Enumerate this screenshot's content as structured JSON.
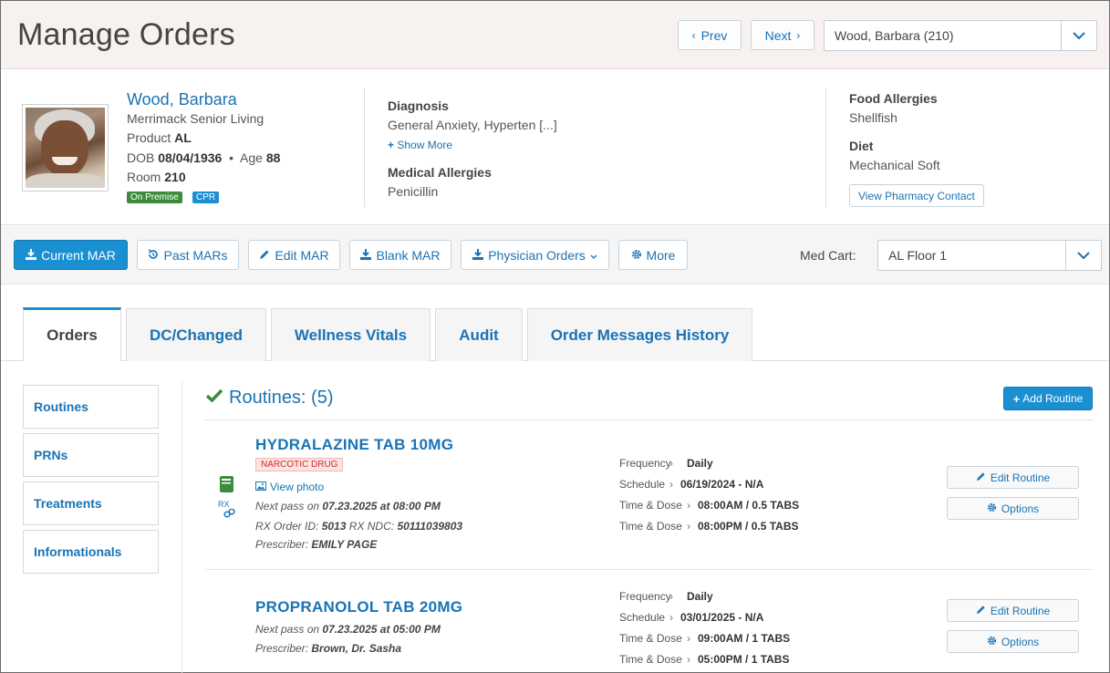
{
  "header": {
    "title": "Manage Orders",
    "prev_label": "Prev",
    "next_label": "Next",
    "patient_select": "Wood, Barbara (210)"
  },
  "patient": {
    "name": "Wood, Barbara",
    "facility": "Merrimack Senior Living",
    "product_label": "Product",
    "product": "AL",
    "dob_label": "DOB",
    "dob": "08/04/1936",
    "age_label": "Age",
    "age": "88",
    "room_label": "Room",
    "room": "210",
    "badges": [
      "On Premise",
      "CPR"
    ],
    "diagnosis_label": "Diagnosis",
    "diagnosis": "General Anxiety, Hyperten [...]",
    "show_more": "Show More",
    "med_allergies_label": "Medical Allergies",
    "med_allergies": "Penicillin",
    "food_allergies_label": "Food Allergies",
    "food_allergies": "Shellfish",
    "diet_label": "Diet",
    "diet": "Mechanical Soft",
    "pharmacy_button": "View Pharmacy Contact"
  },
  "toolbar": {
    "current_mar": "Current MAR",
    "past_mars": "Past MARs",
    "edit_mar": "Edit MAR",
    "blank_mar": "Blank MAR",
    "physician_orders": "Physician Orders",
    "more": "More",
    "med_cart_label": "Med Cart:",
    "med_cart": "AL Floor 1"
  },
  "tabs": [
    "Orders",
    "DC/Changed",
    "Wellness Vitals",
    "Audit",
    "Order Messages History"
  ],
  "side_nav": [
    "Routines",
    "PRNs",
    "Treatments",
    "Informationals"
  ],
  "routines": {
    "title": "Routines: (5)",
    "add_button": "Add Routine",
    "items": [
      {
        "name": "HYDRALAZINE TAB 10MG",
        "tag": "NARCOTIC DRUG",
        "view_photo": "View photo",
        "next_pass_label": "Next pass on",
        "next_pass": "07.23.2025 at 08:00 PM",
        "rx_order_label": "RX Order ID:",
        "rx_order": "5013",
        "rx_ndc_label": "RX NDC:",
        "rx_ndc": "50111039803",
        "prescriber_label": "Prescriber:",
        "prescriber": "EMILY PAGE",
        "rx_icon_label": "RX",
        "frequency_label": "Frequency",
        "frequency": "Daily",
        "schedule_label": "Schedule",
        "schedule": "06/19/2024 - N/A",
        "times": [
          {
            "label": "Time & Dose",
            "value": "08:00AM / 0.5 TABS"
          },
          {
            "label": "Time & Dose",
            "value": "08:00PM / 0.5 TABS"
          }
        ],
        "edit_button": "Edit Routine",
        "options_button": "Options"
      },
      {
        "name": "PROPRANOLOL TAB 20MG",
        "next_pass_label": "Next pass on",
        "next_pass": "07.23.2025 at 05:00 PM",
        "prescriber_label": "Prescriber:",
        "prescriber": "Brown, Dr. Sasha",
        "frequency_label": "Frequency",
        "frequency": "Daily",
        "schedule_label": "Schedule",
        "schedule": "03/01/2025 - N/A",
        "times": [
          {
            "label": "Time & Dose",
            "value": "09:00AM / 1 TABS"
          },
          {
            "label": "Time & Dose",
            "value": "05:00PM / 1 TABS"
          }
        ],
        "edit_button": "Edit Routine",
        "options_button": "Options"
      }
    ]
  }
}
